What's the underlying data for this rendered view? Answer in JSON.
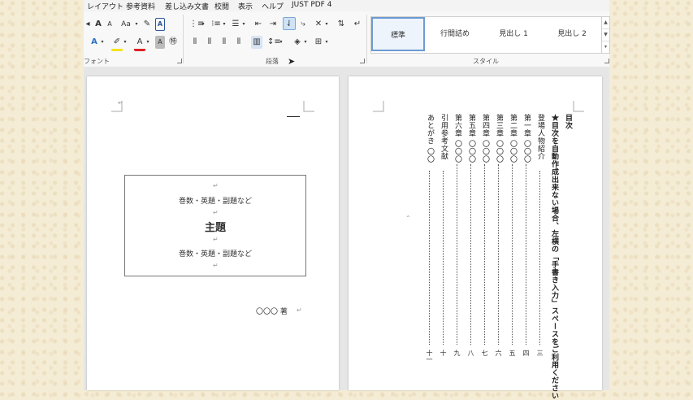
{
  "menu": {
    "items": [
      "レイアウト",
      "参考資料",
      "差し込み文書",
      "校閲",
      "表示",
      "ヘルプ",
      "JUST PDF 4"
    ]
  },
  "ribbon": {
    "font_group_label": "フォント",
    "paragraph_group_label": "段落",
    "styles_group_label": "スタイル",
    "font_size_label": "Aa",
    "styles": [
      "標準",
      "行間詰め",
      "見出し 1",
      "見出し 2"
    ]
  },
  "page1": {
    "box_lines": [
      "巻数・英題・副題など",
      "主題",
      "巻数・英題・副題など"
    ],
    "author": "〇〇〇 著",
    "return_mark": "↵"
  },
  "page2": {
    "toc_title": "目次",
    "note": "★目次を自動作成出来ない場合、左横の「手書き入力」スペースをご利用ください",
    "entries": [
      {
        "label": "登場人物紹介",
        "page": "三"
      },
      {
        "label": "第一章 〇〇〇",
        "page": "四"
      },
      {
        "label": "第二章 〇〇〇",
        "page": "五"
      },
      {
        "label": "第三章 〇〇〇",
        "page": "六"
      },
      {
        "label": "第四章 〇〇〇",
        "page": "七"
      },
      {
        "label": "第五章 〇〇〇",
        "page": "八"
      },
      {
        "label": "第六章 〇〇〇",
        "page": "九"
      },
      {
        "label": "引用参考文献",
        "page": "十"
      },
      {
        "label": "あとがき 〇〇",
        "page": "十一"
      }
    ]
  }
}
